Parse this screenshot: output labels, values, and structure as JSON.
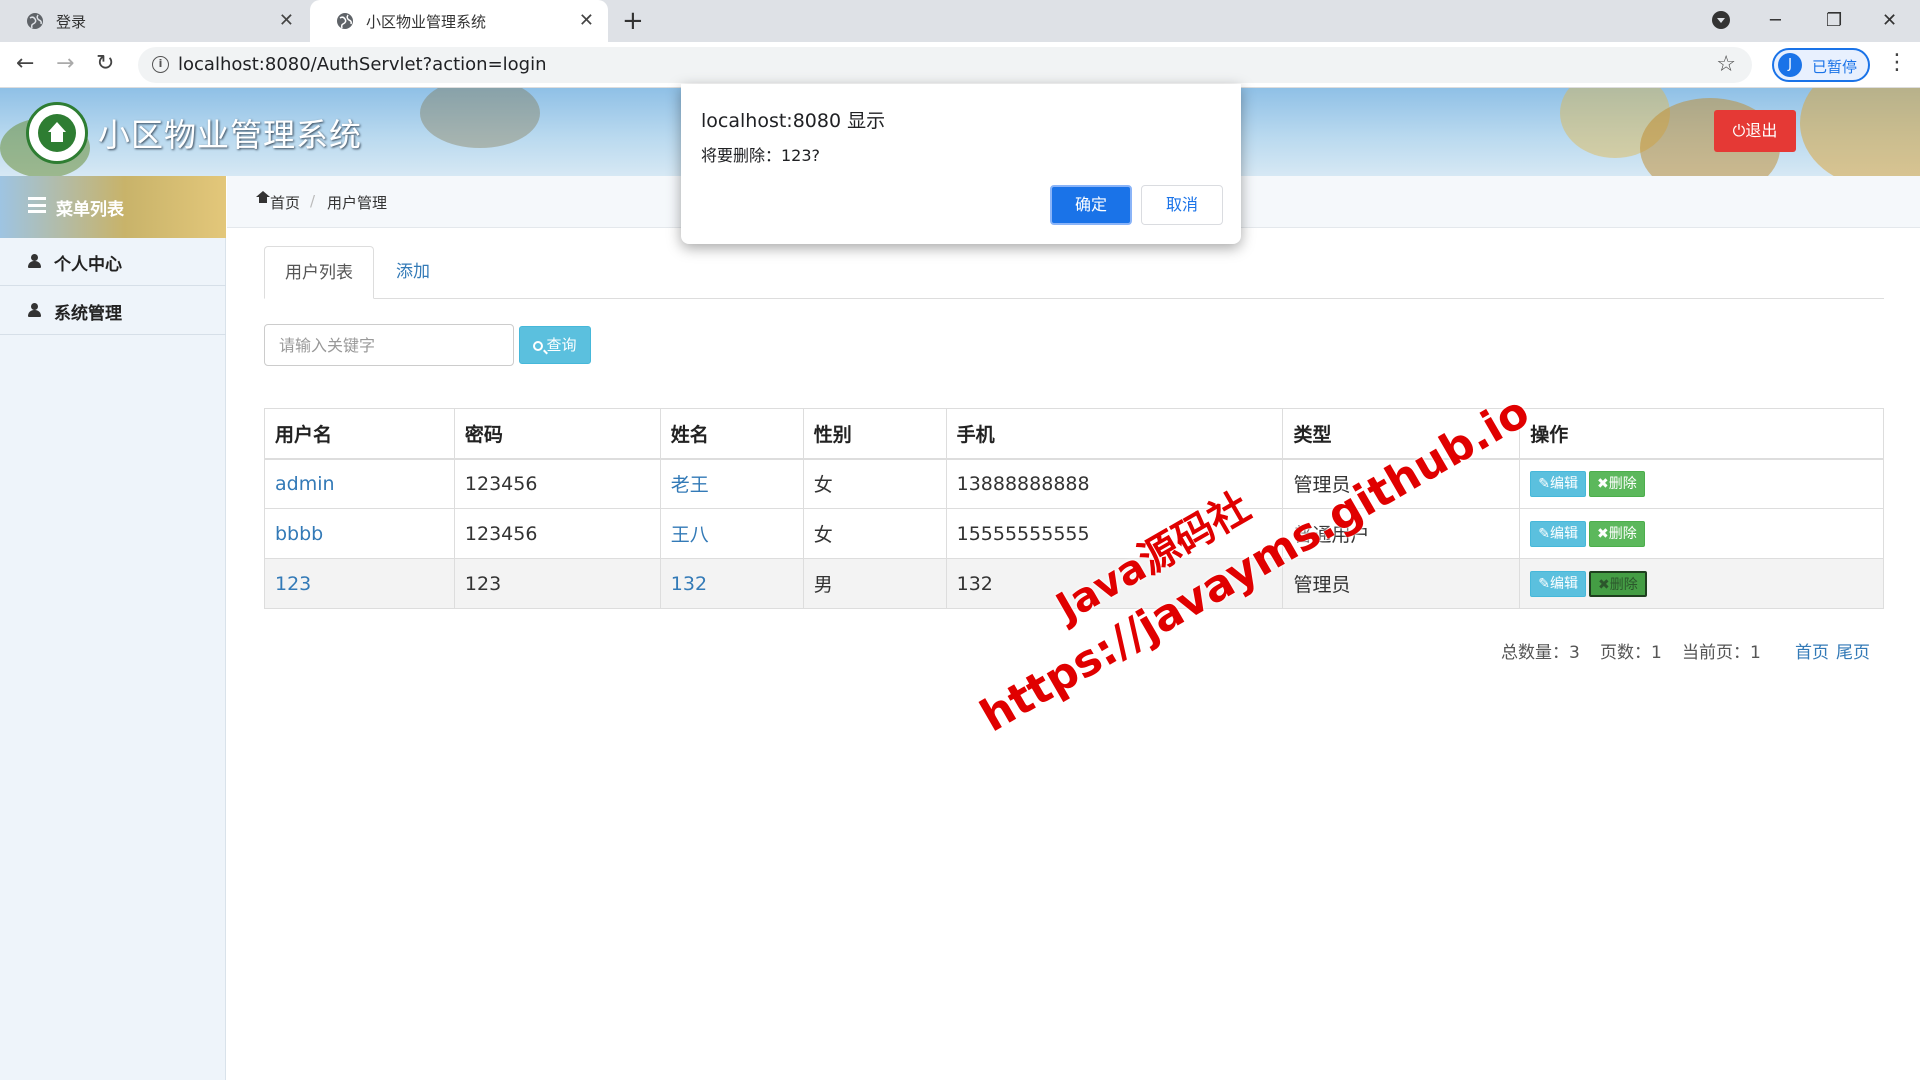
{
  "browser": {
    "tabs": [
      {
        "title": "登录",
        "active": false
      },
      {
        "title": "小区物业管理系统",
        "active": true
      }
    ],
    "url": "localhost:8080/AuthServlet?action=login",
    "profile_initial": "J",
    "profile_label": "已暂停"
  },
  "header": {
    "title": "小区物业管理系统",
    "logout_label": "⏻退出"
  },
  "sidebar": {
    "menu_title": "菜单列表",
    "items": [
      {
        "label": "个人中心"
      },
      {
        "label": "系统管理"
      }
    ]
  },
  "breadcrumb": {
    "home": "首页",
    "separator": "/",
    "current": "用户管理"
  },
  "tabs": [
    {
      "label": "用户列表",
      "active": true
    },
    {
      "label": "添加",
      "active": false
    }
  ],
  "search": {
    "placeholder": "请输入关键字",
    "button_label": "查询"
  },
  "table": {
    "headers": [
      "用户名",
      "密码",
      "姓名",
      "性别",
      "手机",
      "类型",
      "操作"
    ],
    "rows": [
      {
        "username": "admin",
        "password": "123456",
        "name": "老王",
        "gender": "女",
        "phone": "13888888888",
        "type": "管理员"
      },
      {
        "username": "bbbb",
        "password": "123456",
        "name": "王八",
        "gender": "女",
        "phone": "15555555555",
        "type": "普通用户"
      },
      {
        "username": "123",
        "password": "123",
        "name": "132",
        "gender": "男",
        "phone": "132",
        "type": "管理员"
      }
    ],
    "edit_label": "✎编辑",
    "delete_label": "✖删除"
  },
  "pager": {
    "total": "总数量：3",
    "pages": "页数：1",
    "current": "当前页：1",
    "first": "首页",
    "last": "尾页"
  },
  "dialog": {
    "title": "localhost:8080 显示",
    "message": "将要删除：123?",
    "ok_label": "确定",
    "cancel_label": "取消"
  },
  "watermark": {
    "line1": "Java源码社",
    "line2": "https://javayms.github.io"
  },
  "colors": {
    "primary_link": "#337ab7",
    "info_button": "#5bc0de",
    "success_button": "#5cb85c",
    "logout_button": "#e53935",
    "dialog_ok": "#1a73e8",
    "watermark": "#e00000"
  }
}
